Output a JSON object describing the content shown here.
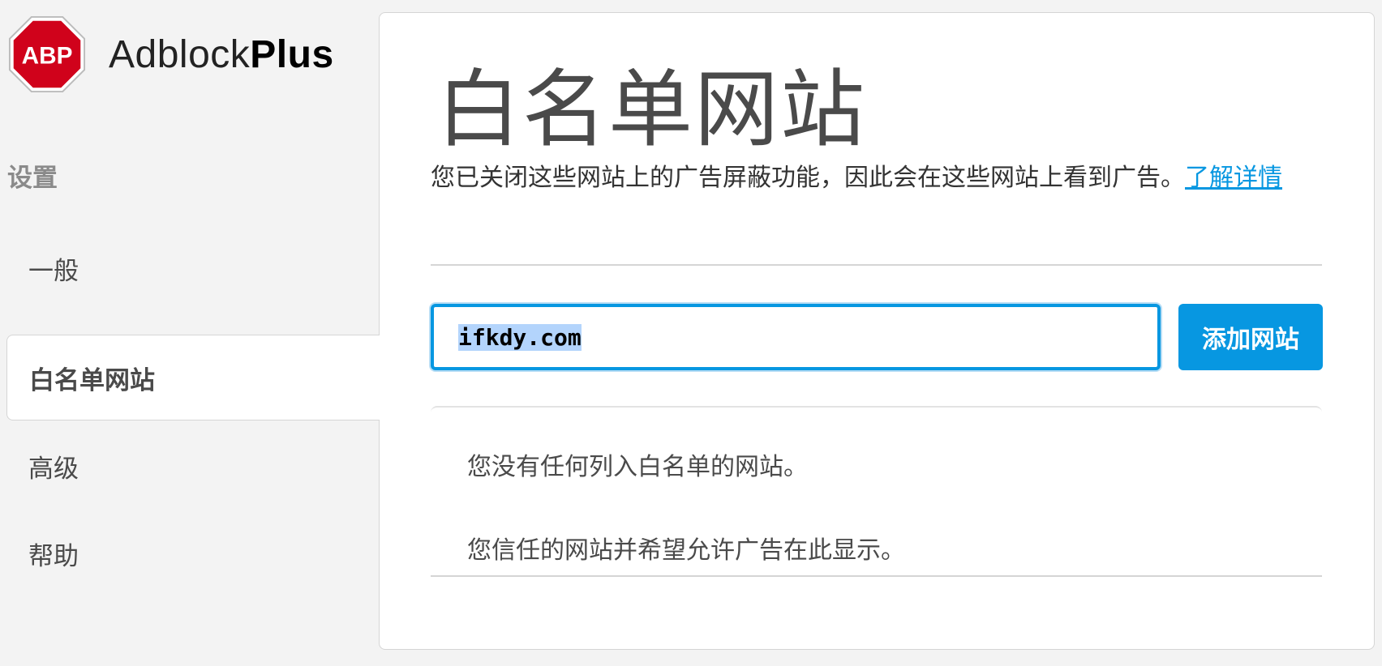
{
  "brand": {
    "badge_text": "ABP",
    "name_light": "Adblock",
    "name_bold": "Plus",
    "badge_color": "#d0021b"
  },
  "sidebar": {
    "heading": "设置",
    "items": [
      {
        "label": "一般",
        "active": false
      },
      {
        "label": "白名单网站",
        "active": true
      },
      {
        "label": "高级",
        "active": false
      },
      {
        "label": "帮助",
        "active": false
      }
    ]
  },
  "main": {
    "title": "白名单网站",
    "description": "您已关闭这些网站上的广告屏蔽功能，因此会在这些网站上看到广告。",
    "learn_more": "了解详情",
    "input_value": "ifkdy.com",
    "add_button": "添加网站",
    "empty_title": "您没有任何列入白名单的网站。",
    "empty_description": "您信任的网站并希望允许广告在此显示。"
  },
  "colors": {
    "accent": "#0797e1",
    "background": "#f3f3f3",
    "panel": "#ffffff",
    "border": "#d5d5d5",
    "text": "#4a4a4a"
  }
}
